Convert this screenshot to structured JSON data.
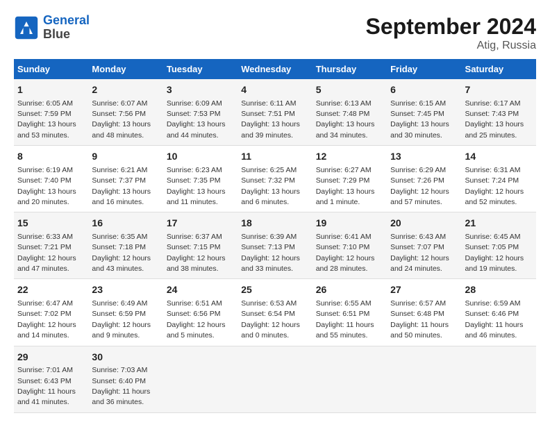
{
  "header": {
    "logo_line1": "General",
    "logo_line2": "Blue",
    "month": "September 2024",
    "location": "Atig, Russia"
  },
  "weekdays": [
    "Sunday",
    "Monday",
    "Tuesday",
    "Wednesday",
    "Thursday",
    "Friday",
    "Saturday"
  ],
  "weeks": [
    [
      {
        "day": "1",
        "sunrise": "Sunrise: 6:05 AM",
        "sunset": "Sunset: 7:59 PM",
        "daylight": "Daylight: 13 hours and 53 minutes."
      },
      {
        "day": "2",
        "sunrise": "Sunrise: 6:07 AM",
        "sunset": "Sunset: 7:56 PM",
        "daylight": "Daylight: 13 hours and 48 minutes."
      },
      {
        "day": "3",
        "sunrise": "Sunrise: 6:09 AM",
        "sunset": "Sunset: 7:53 PM",
        "daylight": "Daylight: 13 hours and 44 minutes."
      },
      {
        "day": "4",
        "sunrise": "Sunrise: 6:11 AM",
        "sunset": "Sunset: 7:51 PM",
        "daylight": "Daylight: 13 hours and 39 minutes."
      },
      {
        "day": "5",
        "sunrise": "Sunrise: 6:13 AM",
        "sunset": "Sunset: 7:48 PM",
        "daylight": "Daylight: 13 hours and 34 minutes."
      },
      {
        "day": "6",
        "sunrise": "Sunrise: 6:15 AM",
        "sunset": "Sunset: 7:45 PM",
        "daylight": "Daylight: 13 hours and 30 minutes."
      },
      {
        "day": "7",
        "sunrise": "Sunrise: 6:17 AM",
        "sunset": "Sunset: 7:43 PM",
        "daylight": "Daylight: 13 hours and 25 minutes."
      }
    ],
    [
      {
        "day": "8",
        "sunrise": "Sunrise: 6:19 AM",
        "sunset": "Sunset: 7:40 PM",
        "daylight": "Daylight: 13 hours and 20 minutes."
      },
      {
        "day": "9",
        "sunrise": "Sunrise: 6:21 AM",
        "sunset": "Sunset: 7:37 PM",
        "daylight": "Daylight: 13 hours and 16 minutes."
      },
      {
        "day": "10",
        "sunrise": "Sunrise: 6:23 AM",
        "sunset": "Sunset: 7:35 PM",
        "daylight": "Daylight: 13 hours and 11 minutes."
      },
      {
        "day": "11",
        "sunrise": "Sunrise: 6:25 AM",
        "sunset": "Sunset: 7:32 PM",
        "daylight": "Daylight: 13 hours and 6 minutes."
      },
      {
        "day": "12",
        "sunrise": "Sunrise: 6:27 AM",
        "sunset": "Sunset: 7:29 PM",
        "daylight": "Daylight: 13 hours and 1 minute."
      },
      {
        "day": "13",
        "sunrise": "Sunrise: 6:29 AM",
        "sunset": "Sunset: 7:26 PM",
        "daylight": "Daylight: 12 hours and 57 minutes."
      },
      {
        "day": "14",
        "sunrise": "Sunrise: 6:31 AM",
        "sunset": "Sunset: 7:24 PM",
        "daylight": "Daylight: 12 hours and 52 minutes."
      }
    ],
    [
      {
        "day": "15",
        "sunrise": "Sunrise: 6:33 AM",
        "sunset": "Sunset: 7:21 PM",
        "daylight": "Daylight: 12 hours and 47 minutes."
      },
      {
        "day": "16",
        "sunrise": "Sunrise: 6:35 AM",
        "sunset": "Sunset: 7:18 PM",
        "daylight": "Daylight: 12 hours and 43 minutes."
      },
      {
        "day": "17",
        "sunrise": "Sunrise: 6:37 AM",
        "sunset": "Sunset: 7:15 PM",
        "daylight": "Daylight: 12 hours and 38 minutes."
      },
      {
        "day": "18",
        "sunrise": "Sunrise: 6:39 AM",
        "sunset": "Sunset: 7:13 PM",
        "daylight": "Daylight: 12 hours and 33 minutes."
      },
      {
        "day": "19",
        "sunrise": "Sunrise: 6:41 AM",
        "sunset": "Sunset: 7:10 PM",
        "daylight": "Daylight: 12 hours and 28 minutes."
      },
      {
        "day": "20",
        "sunrise": "Sunrise: 6:43 AM",
        "sunset": "Sunset: 7:07 PM",
        "daylight": "Daylight: 12 hours and 24 minutes."
      },
      {
        "day": "21",
        "sunrise": "Sunrise: 6:45 AM",
        "sunset": "Sunset: 7:05 PM",
        "daylight": "Daylight: 12 hours and 19 minutes."
      }
    ],
    [
      {
        "day": "22",
        "sunrise": "Sunrise: 6:47 AM",
        "sunset": "Sunset: 7:02 PM",
        "daylight": "Daylight: 12 hours and 14 minutes."
      },
      {
        "day": "23",
        "sunrise": "Sunrise: 6:49 AM",
        "sunset": "Sunset: 6:59 PM",
        "daylight": "Daylight: 12 hours and 9 minutes."
      },
      {
        "day": "24",
        "sunrise": "Sunrise: 6:51 AM",
        "sunset": "Sunset: 6:56 PM",
        "daylight": "Daylight: 12 hours and 5 minutes."
      },
      {
        "day": "25",
        "sunrise": "Sunrise: 6:53 AM",
        "sunset": "Sunset: 6:54 PM",
        "daylight": "Daylight: 12 hours and 0 minutes."
      },
      {
        "day": "26",
        "sunrise": "Sunrise: 6:55 AM",
        "sunset": "Sunset: 6:51 PM",
        "daylight": "Daylight: 11 hours and 55 minutes."
      },
      {
        "day": "27",
        "sunrise": "Sunrise: 6:57 AM",
        "sunset": "Sunset: 6:48 PM",
        "daylight": "Daylight: 11 hours and 50 minutes."
      },
      {
        "day": "28",
        "sunrise": "Sunrise: 6:59 AM",
        "sunset": "Sunset: 6:46 PM",
        "daylight": "Daylight: 11 hours and 46 minutes."
      }
    ],
    [
      {
        "day": "29",
        "sunrise": "Sunrise: 7:01 AM",
        "sunset": "Sunset: 6:43 PM",
        "daylight": "Daylight: 11 hours and 41 minutes."
      },
      {
        "day": "30",
        "sunrise": "Sunrise: 7:03 AM",
        "sunset": "Sunset: 6:40 PM",
        "daylight": "Daylight: 11 hours and 36 minutes."
      },
      null,
      null,
      null,
      null,
      null
    ]
  ]
}
